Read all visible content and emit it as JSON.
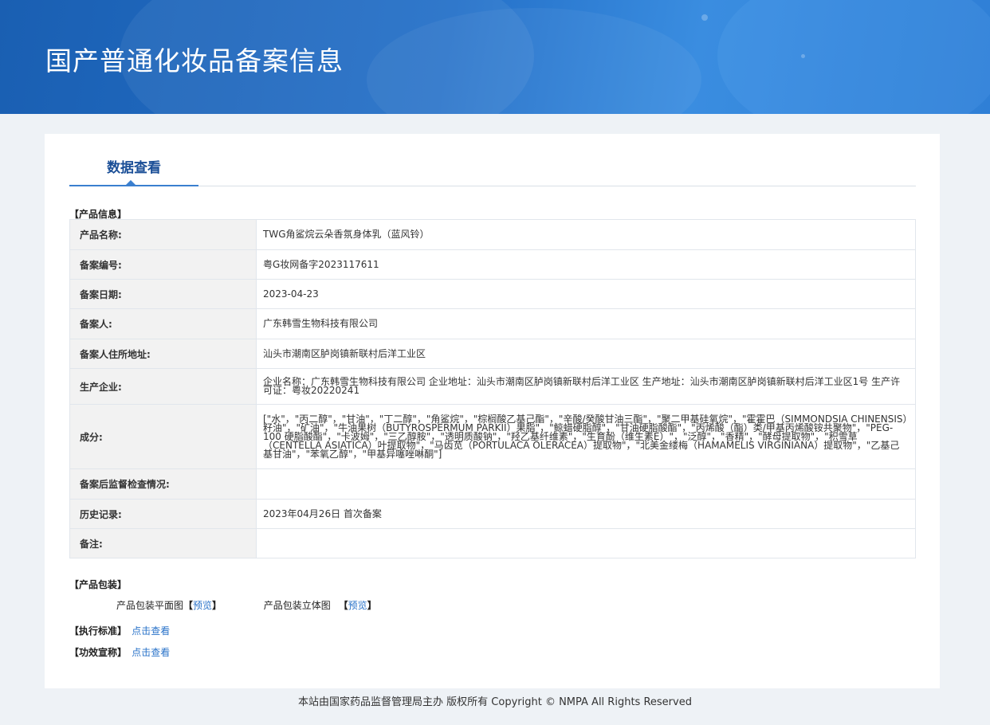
{
  "banner": {
    "title": "国产普通化妆品备案信息"
  },
  "tab": {
    "label": "数据查看"
  },
  "product_info": {
    "section_title": "【产品信息】",
    "rows": [
      {
        "label": "产品名称:",
        "value": "TWG角鲨烷云朵香氛身体乳（蓝风铃）"
      },
      {
        "label": "备案编号:",
        "value": "粤G妆网备字2023117611"
      },
      {
        "label": "备案日期:",
        "value": "2023-04-23"
      },
      {
        "label": "备案人:",
        "value": "广东韩雪生物科技有限公司"
      },
      {
        "label": "备案人住所地址:",
        "value": "汕头市潮南区胪岗镇新联村后洋工业区"
      },
      {
        "label": "生产企业:",
        "value": "企业名称：广东韩雪生物科技有限公司 企业地址：汕头市潮南区胪岗镇新联村后洋工业区 生产地址：汕头市潮南区胪岗镇新联村后洋工业区1号 生产许可证：粤妆20220241"
      },
      {
        "label": "成分:",
        "value": "[\"水\"，\"丙二醇\"，\"甘油\"，\"丁二醇\"，\"角鲨烷\"，\"棕榈酸乙基己酯\"，\"辛酸/癸酸甘油三酯\"，\"聚二甲基硅氧烷\"，\"霍霍巴（SIMMONDSIA CHINENSIS）籽油\"，\"矿油\"，\"牛油果树（BUTYROSPERMUM PARKII）果脂\"，\"鲸蜡硬脂醇\"，\"甘油硬脂酸酯\"，\"丙烯酸（酯）类/甲基丙烯酸铵共聚物\"，\"PEG-100 硬脂酸酯\"，\"卡波姆\"，\"三乙醇胺\"，\"透明质酸钠\"，\"羟乙基纤维素\"，\"生育酚（维生素E）\"，\"泛醇\"，\"香精\"，\"酵母提取物\"，\"积雪草（CENTELLA ASIATICA）叶提取物\"，\"马齿苋（PORTULACA OLERACEA）提取物\"，\"北美金缕梅（HAMAMELIS VIRGINIANA）提取物\"，\"乙基己基甘油\"，\"苯氧乙醇\"，\"甲基异噻唑啉酮\"]"
      },
      {
        "label": "备案后监督检查情况:",
        "value": ""
      },
      {
        "label": "历史记录:",
        "value": "2023年04月26日 首次备案"
      },
      {
        "label": "备注:",
        "value": ""
      }
    ]
  },
  "packaging": {
    "section_title": "【产品包装】",
    "flat_label": "产品包装平面图",
    "solid_label": "产品包装立体图",
    "bracket_open": "【",
    "bracket_close": "】",
    "preview_link": "预览"
  },
  "standard": {
    "label": "【执行标准】",
    "link": "点击查看"
  },
  "efficacy": {
    "label": "【功效宣称】",
    "link": "点击查看"
  },
  "footer": {
    "text": "本站由国家药品监督管理局主办 版权所有 Copyright © NMPA All Rights Reserved"
  },
  "colors": {
    "banner": "#2470c8",
    "tab_text": "#1b4f97",
    "link": "#2a73c9",
    "page_bg": "#eef2f6"
  }
}
